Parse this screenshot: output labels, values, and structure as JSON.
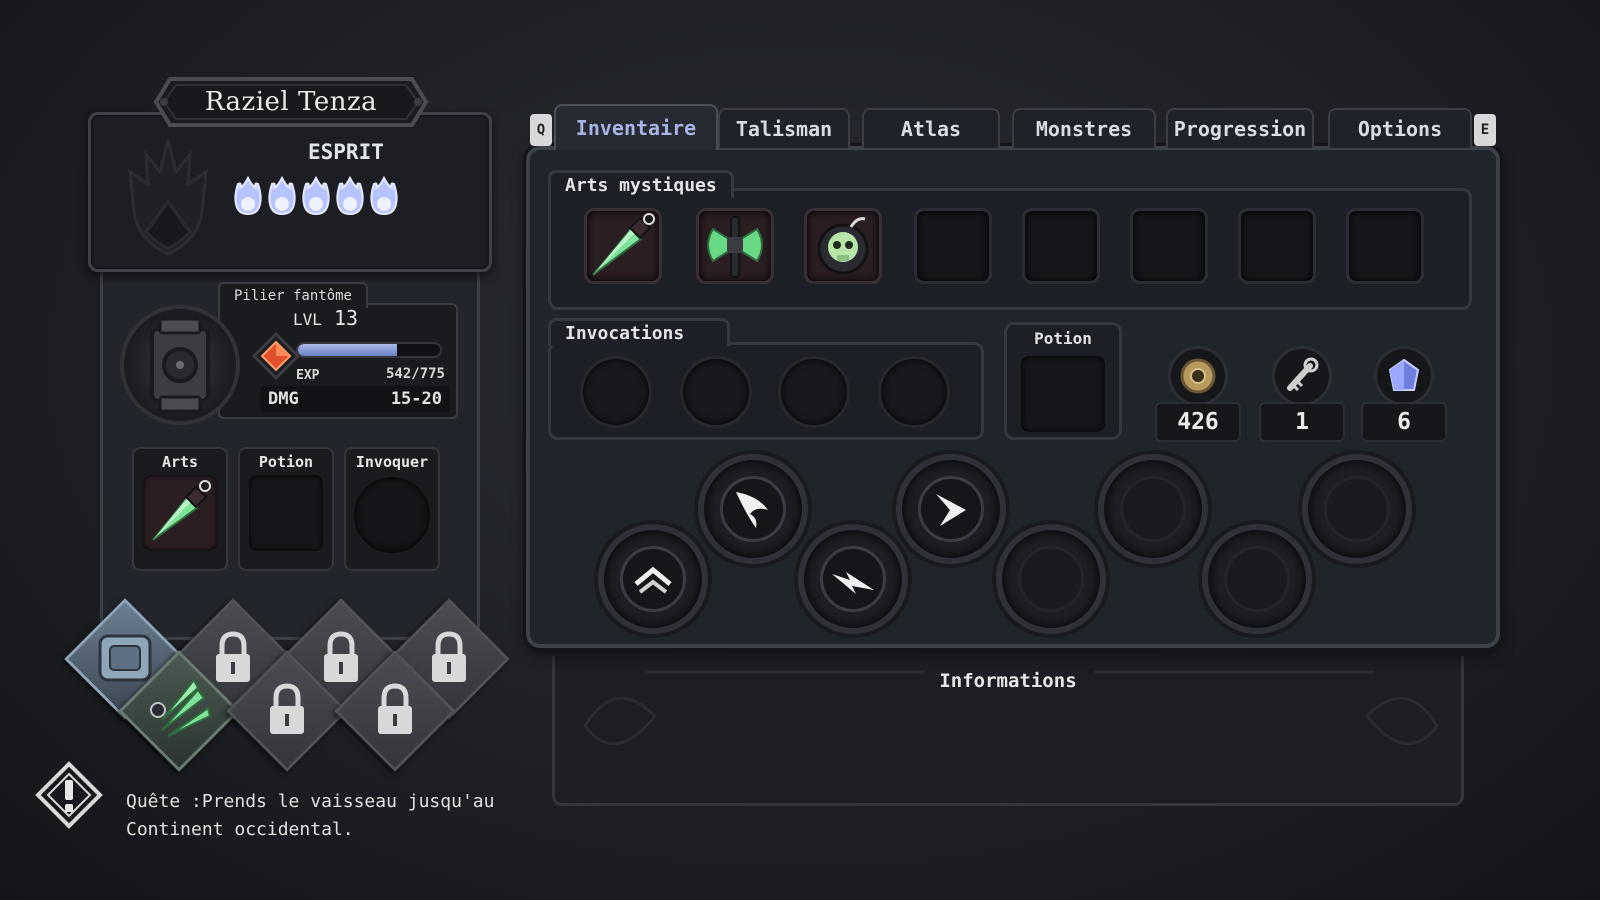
{
  "character": {
    "name": "Raziel Tenza",
    "class_name": "ESPRIT",
    "spirit_flames": 5
  },
  "relic": {
    "title": "Pilier fantôme",
    "level_label": "LVL",
    "level": "13",
    "exp_label": "EXP",
    "exp_value": "542/775",
    "exp_current": 542,
    "exp_max": 775,
    "dmg_label": "DMG",
    "dmg_value": "15-20"
  },
  "quick_slots": {
    "arts_label": "Arts",
    "potion_label": "Potion",
    "invoke_label": "Invoquer"
  },
  "quest": {
    "text_line1": "Quête :Prends le vaisseau jusqu'au",
    "text_line2": "Continent occidental."
  },
  "tabs": [
    {
      "label": "Inventaire",
      "active": true
    },
    {
      "label": "Talisman"
    },
    {
      "label": "Atlas"
    },
    {
      "label": "Monstres"
    },
    {
      "label": "Progression"
    },
    {
      "label": "Options"
    }
  ],
  "tab_keys": {
    "left": "Q",
    "right": "E"
  },
  "inventory": {
    "arts_title": "Arts mystiques",
    "arts_slots": [
      "green-dagger-icon",
      "green-axe-icon",
      "skull-bomb-icon",
      "",
      "",
      "",
      "",
      ""
    ],
    "invocations_title": "Invocations",
    "potion_title": "Potion",
    "resources": [
      {
        "icon": "coin-icon",
        "value": "426"
      },
      {
        "icon": "bone-key-icon",
        "value": "1"
      },
      {
        "icon": "crystal-icon",
        "value": "6"
      }
    ]
  },
  "info": {
    "title": "Informations"
  },
  "colors": {
    "active_tab": "#a7b4e4",
    "exp_bar": "#8ea0dc",
    "flame": "#c9d3ff",
    "gem": "#e0502c"
  }
}
